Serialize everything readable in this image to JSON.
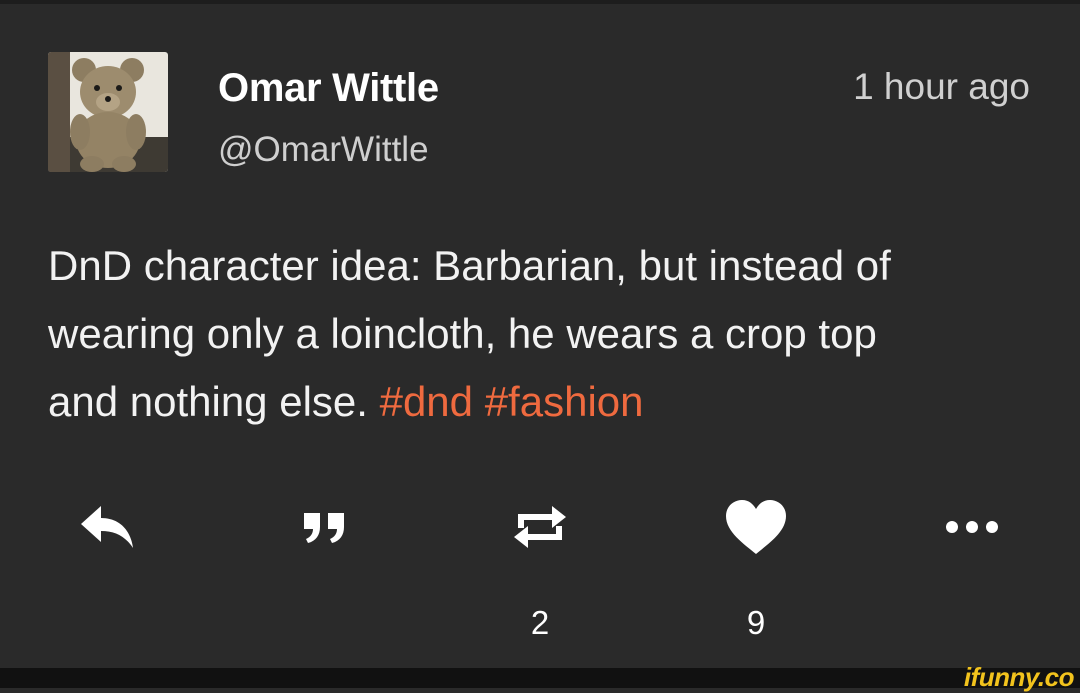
{
  "tweet": {
    "display_name": "Omar Wittle",
    "handle": "@OmarWittle",
    "timestamp": "1 hour ago",
    "text_parts": {
      "line1": "DnD character idea: Barbarian, but instead of",
      "line2": "wearing only a loincloth, he wears a crop top",
      "line3": "and nothing else. ",
      "hashtag1": "#dnd",
      "space": " ",
      "hashtag2": "#fashion"
    }
  },
  "actions": {
    "reply_icon": "reply-arrow-icon",
    "quote_icon": "quote-icon",
    "retweet_icon": "retweet-icon",
    "like_icon": "heart-icon",
    "more_icon": "ellipsis-icon",
    "retweet_count": "2",
    "like_count": "9"
  },
  "watermark": {
    "text": "ifunny.co"
  },
  "colors": {
    "background": "#2a2a2a",
    "hashtag": "#ef6a3f",
    "watermark": "#f2c31d"
  }
}
